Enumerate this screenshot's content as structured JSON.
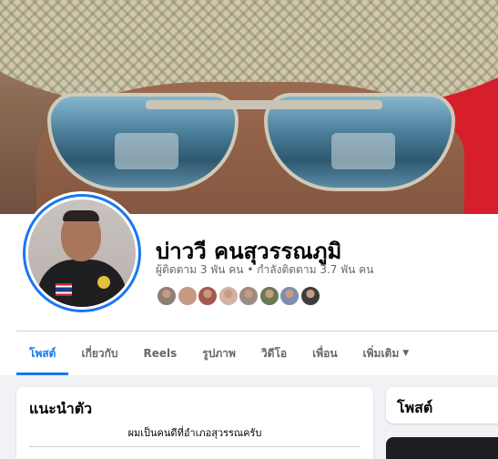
{
  "profile": {
    "name": "บ่าววี คนสุวรรณภูมิ",
    "followers_label": "ผู้ติดตาม",
    "followers_count": "3 พัน",
    "followers_unit": "คน",
    "following_label": "กำลังติดตาม",
    "following_count": "3.7 พัน",
    "following_unit": "คน",
    "bullet": "•"
  },
  "tabs": [
    {
      "label": "โพสต์"
    },
    {
      "label": "เกี่ยวกับ"
    },
    {
      "label": "Reels"
    },
    {
      "label": "รูปภาพ"
    },
    {
      "label": "วิดีโอ"
    },
    {
      "label": "เพื่อน"
    },
    {
      "label": "เพิ่มเติม"
    }
  ],
  "intro": {
    "title": "แนะนำตัว",
    "bio": "ผมเป็นคนดีที่อำเภอสุวรรณครับ"
  },
  "posts": {
    "title": "โพสต์"
  },
  "colors": {
    "accent": "#1877f2",
    "text": "#050505",
    "muted": "#65676b"
  },
  "friend_avatars": [
    "#8d7f74",
    "#c49a85",
    "#a4594f",
    "#d0b3a6",
    "#9c8b85",
    "#6a7a55",
    "#7c8fb0",
    "#3d3d40"
  ]
}
